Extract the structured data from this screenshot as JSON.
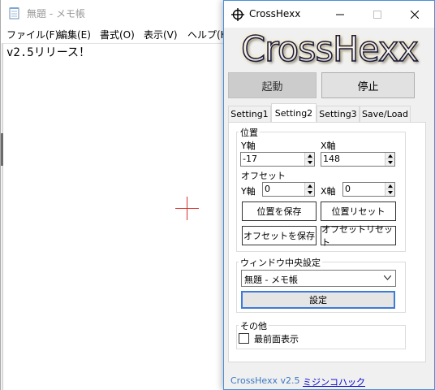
{
  "notepad": {
    "title": "無題 - メモ帳",
    "menu": [
      "ファイル(F)",
      "編集(E)",
      "書式(O)",
      "表示(V)",
      "ヘルプ(H)"
    ],
    "content": "v2.5リリース！"
  },
  "crosshexx": {
    "window_title": "CrossHexx",
    "logo_text": "CrossHexx",
    "start_label": "起動",
    "stop_label": "停止",
    "tabs": [
      "Setting1",
      "Setting2",
      "Setting3",
      "Save/Load"
    ],
    "active_tab": "Setting2",
    "position": {
      "group_label": "位置",
      "y_label": "Y軸",
      "x_label": "X軸",
      "y_value": "-17",
      "x_value": "148"
    },
    "offset": {
      "label": "オフセット",
      "y_label": "Y軸",
      "x_label": "X軸",
      "y_value": "0",
      "x_value": "0"
    },
    "buttons": {
      "save_position": "位置を保存",
      "reset_position": "位置リセット",
      "save_offset": "オフセットを保存",
      "reset_offset": "オフセットリセット"
    },
    "window_center": {
      "group_label": "ウィンドウ中央設定",
      "selected_window": "無題 - メモ帳",
      "set_label": "設定"
    },
    "other": {
      "group_label": "その他",
      "topmost_label": "最前面表示",
      "topmost_checked": false
    },
    "footer": {
      "version": "CrossHexx v2.5",
      "link": "ミジンコハック"
    }
  },
  "colors": {
    "crosshair": "#d8312c",
    "window_border": "#4a90d9",
    "link": "#0000cc",
    "version_text": "#3b78c2"
  },
  "icons": [
    "notepad-icon",
    "crosshair-icon",
    "minimize-icon",
    "maximize-icon",
    "close-icon",
    "spin-up-icon",
    "spin-down-icon",
    "chevron-down-icon"
  ]
}
